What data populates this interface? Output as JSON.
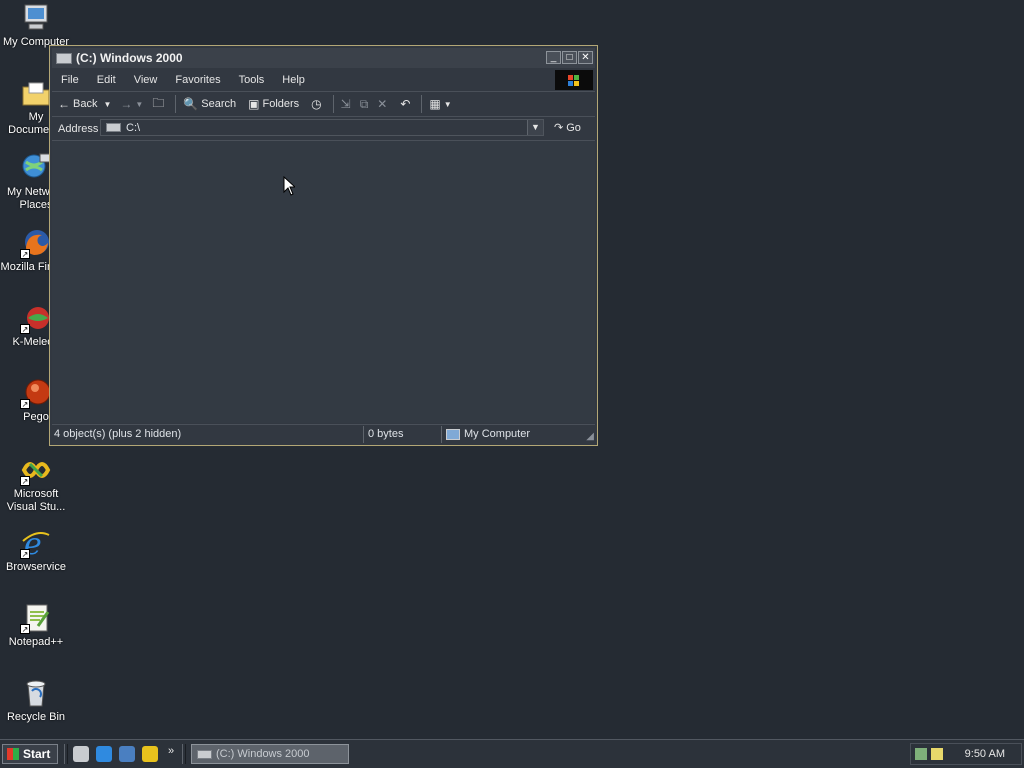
{
  "desktop": {
    "icons": [
      {
        "label": "My Computer",
        "icon": "my-computer-icon"
      },
      {
        "label": "My Documents",
        "icon": "my-documents-icon"
      },
      {
        "label": "My Network Places",
        "icon": "network-places-icon"
      },
      {
        "label": "Mozilla Firefox",
        "icon": "firefox-icon"
      },
      {
        "label": "K-Meleon",
        "icon": "k-meleon-icon"
      },
      {
        "label": "Pego",
        "icon": "pego-icon"
      },
      {
        "label": "Microsoft Visual Stu...",
        "icon": "visual-studio-icon"
      },
      {
        "label": "Browservice",
        "icon": "ie-icon"
      },
      {
        "label": "Notepad++",
        "icon": "notepad-plus-plus-icon"
      },
      {
        "label": "Recycle Bin",
        "icon": "recycle-bin-icon"
      }
    ]
  },
  "window": {
    "title": "(C:) Windows 2000",
    "menu": [
      "File",
      "Edit",
      "View",
      "Favorites",
      "Tools",
      "Help"
    ],
    "toolbar": {
      "back": "Back",
      "search": "Search",
      "folders": "Folders"
    },
    "address": {
      "label": "Address",
      "value": "C:\\",
      "go": "Go"
    },
    "status": {
      "objects": "4 object(s) (plus 2 hidden)",
      "size": "0 bytes",
      "location": "My Computer"
    }
  },
  "taskbar": {
    "start": "Start",
    "task": "(C:) Windows 2000",
    "clock": "9:50 AM",
    "chevron": "»"
  },
  "colors": {
    "desktop_bg": "#252b33",
    "window_border": "#b3a776",
    "window_bg": "#323841"
  }
}
